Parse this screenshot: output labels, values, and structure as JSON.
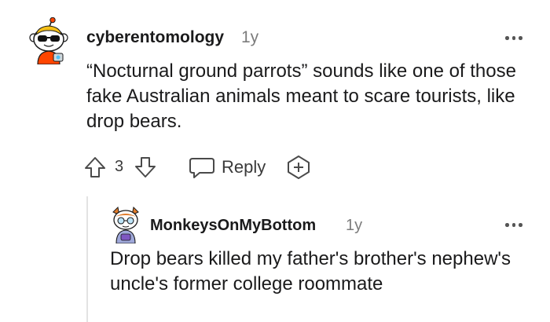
{
  "comment": {
    "username": "cyberentomology",
    "age": "1y",
    "body": "“Nocturnal ground parrots” sounds like one of those fake Australian animals meant to scare tourists, like drop bears.",
    "votes": "3",
    "reply_label": "Reply"
  },
  "reply": {
    "username": "MonkeysOnMyBottom",
    "age": "1y",
    "body": "Drop bears killed my father's brother's nephew's uncle's former college roommate"
  },
  "colors": {
    "text": "#1a1a1b",
    "meta": "#7c7c7c",
    "icon": "#4a4a4a",
    "thread_line": "#e3e3e3"
  }
}
